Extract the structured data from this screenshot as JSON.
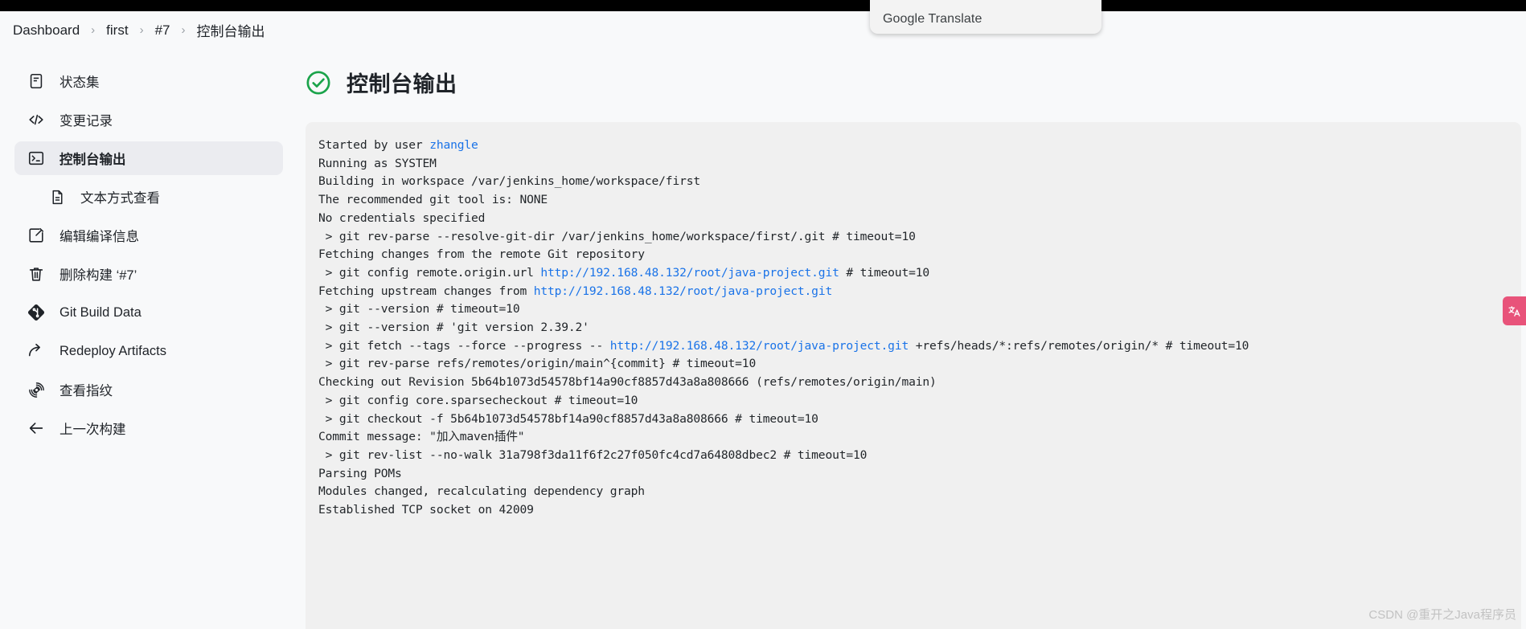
{
  "browser": {
    "translate_popup_label": "Google Translate",
    "translate_tab_icon": "translate-icon"
  },
  "breadcrumb": {
    "separator": "›",
    "items": [
      {
        "label": "Dashboard"
      },
      {
        "label": "first"
      },
      {
        "label": "#7"
      },
      {
        "label": "控制台输出"
      }
    ]
  },
  "sidebar": {
    "items": [
      {
        "label": "状态集",
        "icon": "document-icon",
        "active": false,
        "sub": false
      },
      {
        "label": "变更记录",
        "icon": "code-icon",
        "active": false,
        "sub": false
      },
      {
        "label": "控制台输出",
        "icon": "terminal-icon",
        "active": true,
        "sub": false
      },
      {
        "label": "文本方式查看",
        "icon": "file-text-icon",
        "active": false,
        "sub": true
      },
      {
        "label": "编辑编译信息",
        "icon": "edit-icon",
        "active": false,
        "sub": false
      },
      {
        "label": "删除构建 ‘#7’",
        "icon": "trash-icon",
        "active": false,
        "sub": false
      },
      {
        "label": "Git Build Data",
        "icon": "git-icon",
        "active": false,
        "sub": false
      },
      {
        "label": "Redeploy Artifacts",
        "icon": "redeploy-icon",
        "active": false,
        "sub": false
      },
      {
        "label": "查看指纹",
        "icon": "fingerprint-icon",
        "active": false,
        "sub": false
      },
      {
        "label": "上一次构建",
        "icon": "arrow-left-icon",
        "active": false,
        "sub": false
      }
    ]
  },
  "main": {
    "status_icon": "check-circle-icon",
    "status_color": "#1aa34a",
    "title": "控制台输出",
    "console": {
      "link_color": "#1a73e8",
      "lines": [
        [
          {
            "t": "Started by user "
          },
          {
            "t": "zhangle",
            "link": true
          }
        ],
        [
          {
            "t": "Running as SYSTEM"
          }
        ],
        [
          {
            "t": "Building in workspace /var/jenkins_home/workspace/first"
          }
        ],
        [
          {
            "t": "The recommended git tool is: NONE"
          }
        ],
        [
          {
            "t": "No credentials specified"
          }
        ],
        [
          {
            "t": " > git rev-parse --resolve-git-dir /var/jenkins_home/workspace/first/.git # timeout=10"
          }
        ],
        [
          {
            "t": "Fetching changes from the remote Git repository"
          }
        ],
        [
          {
            "t": " > git config remote.origin.url "
          },
          {
            "t": "http://192.168.48.132/root/java-project.git",
            "link": true
          },
          {
            "t": " # timeout=10"
          }
        ],
        [
          {
            "t": "Fetching upstream changes from "
          },
          {
            "t": "http://192.168.48.132/root/java-project.git",
            "link": true
          }
        ],
        [
          {
            "t": " > git --version # timeout=10"
          }
        ],
        [
          {
            "t": " > git --version # 'git version 2.39.2'"
          }
        ],
        [
          {
            "t": " > git fetch --tags --force --progress -- "
          },
          {
            "t": "http://192.168.48.132/root/java-project.git",
            "link": true
          },
          {
            "t": " +refs/heads/*:refs/remotes/origin/* # timeout=10"
          }
        ],
        [
          {
            "t": " > git rev-parse refs/remotes/origin/main^{commit} # timeout=10"
          }
        ],
        [
          {
            "t": "Checking out Revision 5b64b1073d54578bf14a90cf8857d43a8a808666 (refs/remotes/origin/main)"
          }
        ],
        [
          {
            "t": " > git config core.sparsecheckout # timeout=10"
          }
        ],
        [
          {
            "t": " > git checkout -f 5b64b1073d54578bf14a90cf8857d43a8a808666 # timeout=10"
          }
        ],
        [
          {
            "t": "Commit message: \"加入maven插件\""
          }
        ],
        [
          {
            "t": " > git rev-list --no-walk 31a798f3da11f6f2c27f050fc4cd7a64808dbec2 # timeout=10"
          }
        ],
        [
          {
            "t": "Parsing POMs"
          }
        ],
        [
          {
            "t": "Modules changed, recalculating dependency graph"
          }
        ],
        [
          {
            "t": "Established TCP socket on 42009"
          }
        ]
      ]
    }
  },
  "watermark": {
    "label": "CSDN @重开之Java程序员"
  }
}
